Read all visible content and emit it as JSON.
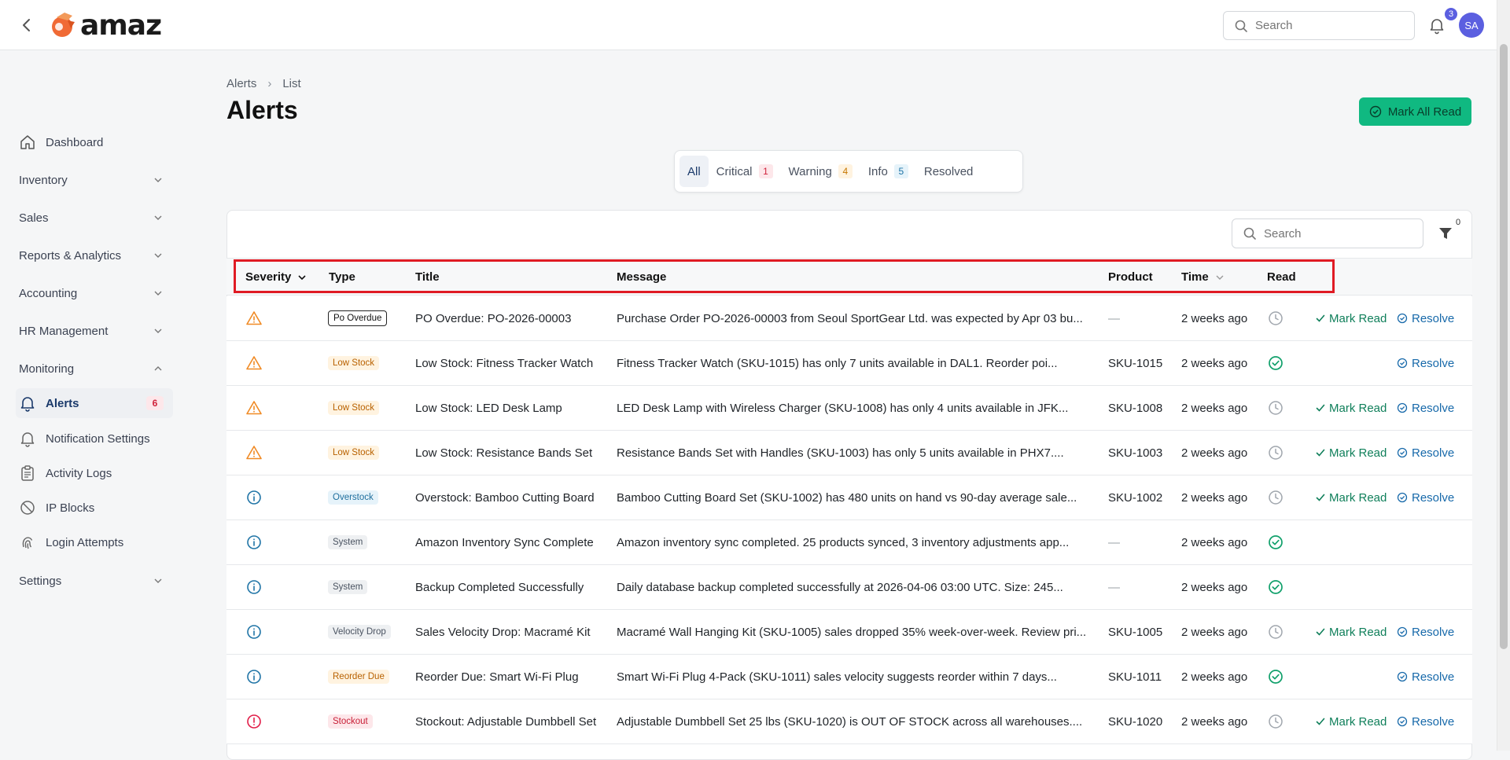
{
  "header": {
    "logo_text": "amaz",
    "search_placeholder": "Search",
    "notification_count": "3",
    "avatar_initials": "SA",
    "brand_color": "#f06a35"
  },
  "sidebar": {
    "items": [
      {
        "label": "Dashboard",
        "icon": "home-icon"
      },
      {
        "label": "Inventory"
      },
      {
        "label": "Sales"
      },
      {
        "label": "Reports & Analytics"
      },
      {
        "label": "Accounting"
      },
      {
        "label": "HR Management"
      },
      {
        "label": "Monitoring"
      },
      {
        "label": "Alerts",
        "icon": "bell-icon",
        "badge": "6"
      },
      {
        "label": "Notification Settings",
        "icon": "bell-icon"
      },
      {
        "label": "Activity Logs",
        "icon": "clipboard-icon"
      },
      {
        "label": "IP Blocks",
        "icon": "ban-icon"
      },
      {
        "label": "Login Attempts",
        "icon": "fingerprint-icon"
      },
      {
        "label": "Settings"
      }
    ]
  },
  "breadcrumb": {
    "root": "Alerts",
    "current": "List"
  },
  "page": {
    "title": "Alerts",
    "mark_all_label": "Mark All Read"
  },
  "tabs": [
    {
      "label": "All"
    },
    {
      "label": "Critical",
      "count": "1"
    },
    {
      "label": "Warning",
      "count": "4"
    },
    {
      "label": "Info",
      "count": "5"
    },
    {
      "label": "Resolved"
    }
  ],
  "table": {
    "search_placeholder": "Search",
    "filter_count": "0",
    "columns": [
      "Severity",
      "Type",
      "Title",
      "Message",
      "Product",
      "Time",
      "Read"
    ],
    "actions": {
      "mark_read": "Mark Read",
      "resolve": "Resolve"
    },
    "rows": [
      {
        "severity": "warning",
        "type": "Po Overdue",
        "title": "PO Overdue: PO-2026-00003",
        "message": "Purchase Order PO-2026-00003 from Seoul SportGear Ltd. was expected by Apr 03 bu...",
        "product": "—",
        "time": "2 weeks ago",
        "read": false
      },
      {
        "severity": "warning",
        "type": "Low Stock",
        "title": "Low Stock: Fitness Tracker Watch",
        "message": "Fitness Tracker Watch (SKU-1015) has only 7 units available in DAL1. Reorder poi...",
        "product": "SKU-1015",
        "time": "2 weeks ago",
        "read": true
      },
      {
        "severity": "warning",
        "type": "Low Stock",
        "title": "Low Stock: LED Desk Lamp",
        "message": "LED Desk Lamp with Wireless Charger (SKU-1008) has only 4 units available in JFK...",
        "product": "SKU-1008",
        "time": "2 weeks ago",
        "read": false
      },
      {
        "severity": "warning",
        "type": "Low Stock",
        "title": "Low Stock: Resistance Bands Set",
        "message": "Resistance Bands Set with Handles (SKU-1003) has only 5 units available in PHX7....",
        "product": "SKU-1003",
        "time": "2 weeks ago",
        "read": false
      },
      {
        "severity": "info",
        "type": "Overstock",
        "title": "Overstock: Bamboo Cutting Board",
        "message": "Bamboo Cutting Board Set (SKU-1002) has 480 units on hand vs 90-day average sale...",
        "product": "SKU-1002",
        "time": "2 weeks ago",
        "read": false
      },
      {
        "severity": "info",
        "type": "System",
        "title": "Amazon Inventory Sync Complete",
        "message": "Amazon inventory sync completed. 25 products synced, 3 inventory adjustments app...",
        "product": "—",
        "time": "2 weeks ago",
        "read": true
      },
      {
        "severity": "info",
        "type": "System",
        "title": "Backup Completed Successfully",
        "message": "Daily database backup completed successfully at 2026-04-06 03:00 UTC. Size: 245...",
        "product": "—",
        "time": "2 weeks ago",
        "read": true
      },
      {
        "severity": "info",
        "type": "Velocity Drop",
        "title": "Sales Velocity Drop: Macramé Kit",
        "message": "Macramé Wall Hanging Kit (SKU-1005) sales dropped 35% week-over-week. Review pri...",
        "product": "SKU-1005",
        "time": "2 weeks ago",
        "read": false
      },
      {
        "severity": "info",
        "type": "Reorder Due",
        "title": "Reorder Due: Smart Wi-Fi Plug",
        "message": "Smart Wi-Fi Plug 4-Pack (SKU-1011) sales velocity suggests reorder within 7 days...",
        "product": "SKU-1011",
        "time": "2 weeks ago",
        "read": true
      },
      {
        "severity": "critical",
        "type": "Stockout",
        "title": "Stockout: Adjustable Dumbbell Set",
        "message": "Adjustable Dumbbell Set 25 lbs (SKU-1020) is OUT OF STOCK across all warehouses....",
        "product": "SKU-1020",
        "time": "2 weeks ago",
        "read": false
      }
    ]
  },
  "colors": {
    "accent": "#10b981",
    "warning": "#f08a24",
    "info": "#1f74a6",
    "critical": "#e11d48",
    "read_check": "#10a06b",
    "highlight": "#e01b24"
  }
}
